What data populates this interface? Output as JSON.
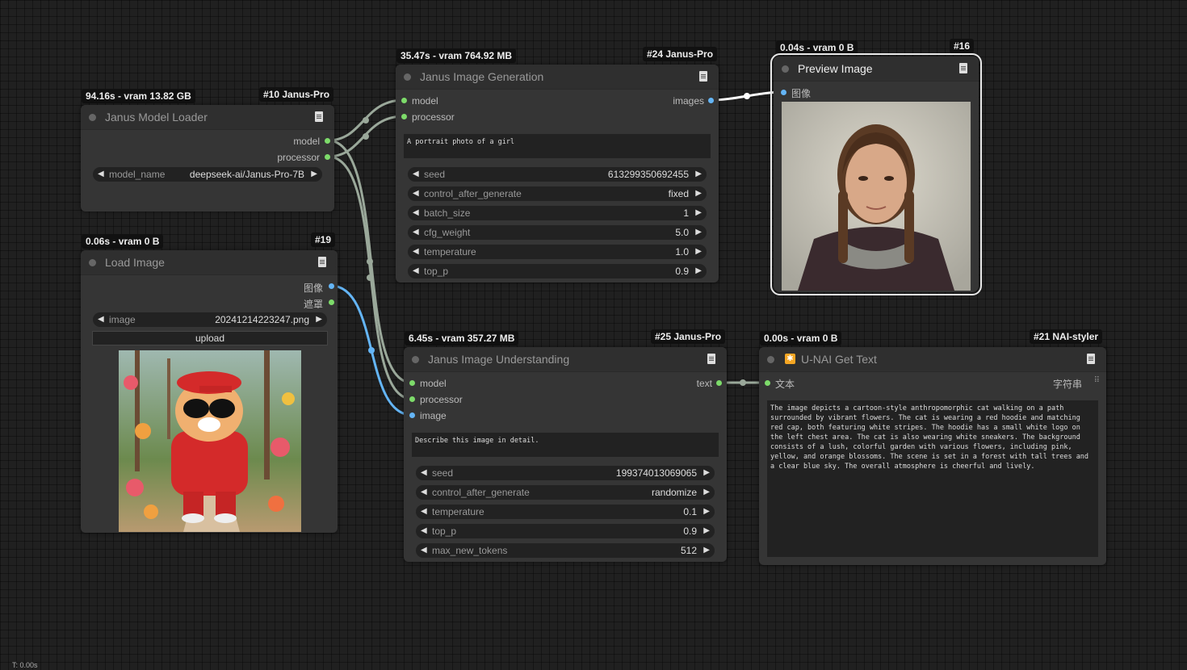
{
  "nodes": {
    "model_loader": {
      "timing": "94.16s - vram 13.82 GB",
      "id_badge": "#10 Janus-Pro",
      "title": "Janus Model Loader",
      "outputs": [
        "model",
        "processor"
      ],
      "widget": {
        "label": "model_name",
        "value": "deepseek-ai/Janus-Pro-7B"
      }
    },
    "load_image": {
      "timing": "0.06s - vram 0 B",
      "id_badge": "#19",
      "title": "Load Image",
      "outputs": [
        "图像",
        "遮罩"
      ],
      "widget": {
        "label": "image",
        "value": "20241214223247.png"
      },
      "upload_label": "upload"
    },
    "generation": {
      "timing": "35.47s - vram 764.92 MB",
      "id_badge": "#24 Janus-Pro",
      "title": "Janus Image Generation",
      "inputs": [
        "model",
        "processor"
      ],
      "output": "images",
      "prompt": "A portrait photo of a girl",
      "widgets": [
        {
          "label": "seed",
          "value": "613299350692455"
        },
        {
          "label": "control_after_generate",
          "value": "fixed"
        },
        {
          "label": "batch_size",
          "value": "1"
        },
        {
          "label": "cfg_weight",
          "value": "5.0"
        },
        {
          "label": "temperature",
          "value": "1.0"
        },
        {
          "label": "top_p",
          "value": "0.9"
        }
      ]
    },
    "preview": {
      "timing": "0.04s - vram 0 B",
      "id_badge": "#16",
      "title": "Preview Image",
      "input": "图像"
    },
    "understanding": {
      "timing": "6.45s - vram 357.27 MB",
      "id_badge": "#25 Janus-Pro",
      "title": "Janus Image Understanding",
      "inputs": [
        "model",
        "processor",
        "image"
      ],
      "output": "text",
      "prompt": "Describe this image in detail.",
      "widgets": [
        {
          "label": "seed",
          "value": "199374013069065"
        },
        {
          "label": "control_after_generate",
          "value": "randomize"
        },
        {
          "label": "temperature",
          "value": "0.1"
        },
        {
          "label": "top_p",
          "value": "0.9"
        },
        {
          "label": "max_new_tokens",
          "value": "512"
        }
      ]
    },
    "get_text": {
      "timing": "0.00s - vram 0 B",
      "id_badge": "#21 NAI-styler",
      "title": "U-NAI Get Text",
      "input": "文本",
      "output": "字符串",
      "text": "The image depicts a cartoon-style anthropomorphic cat walking on a path surrounded by vibrant flowers. The cat is wearing a red hoodie and matching red cap, both featuring white stripes. The hoodie has a small white logo on the left chest area. The cat is also wearing white sneakers. The background consists of a lush, colorful garden with various flowers, including pink, yellow, and orange blossoms. The scene is set in a forest with tall trees and a clear blue sky. The overall atmosphere is cheerful and lively."
    }
  },
  "footer": "T: 0.00s",
  "colors": {
    "model_link": "#9aa89a",
    "image_link": "#64b5f6",
    "output_link": "#ffffff"
  }
}
